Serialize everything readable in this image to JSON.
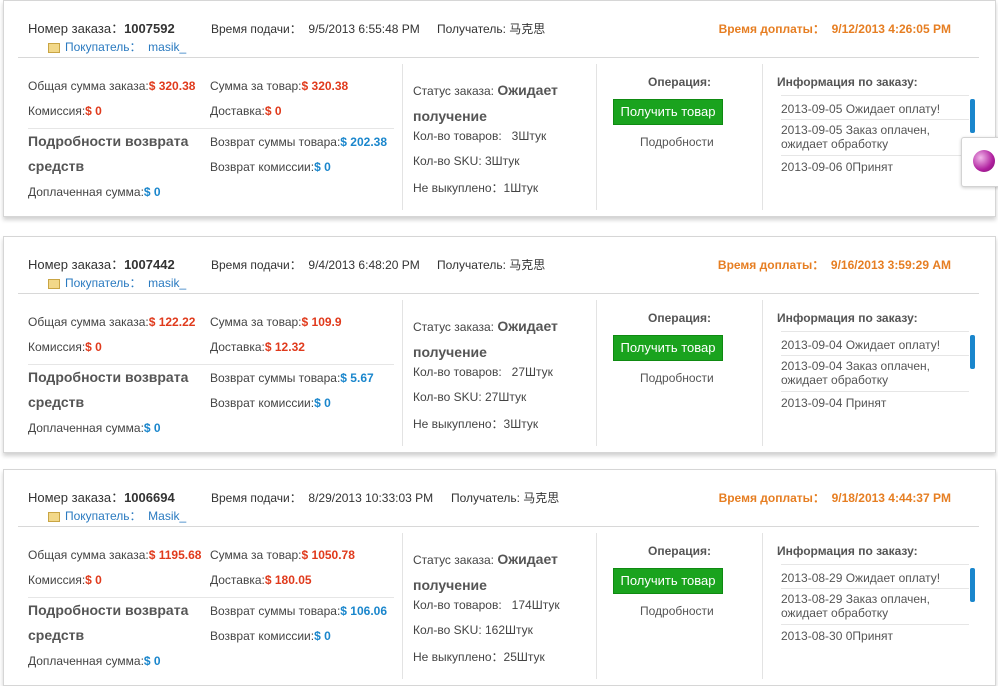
{
  "labels": {
    "order_number": "Номер заказа：",
    "submit_time": "Время подачи：",
    "recipient": "Получатель:",
    "pay_deadline": "Время доплаты：",
    "buyer": "Покупатель：",
    "total_order": "Общая сумма заказа:",
    "goods_sum": "Сумма за товар:",
    "commission": "Комиссия:",
    "delivery": "Доставка:",
    "refund_details": "Подробности возврата средств",
    "refund_goods": "Возврат суммы товара:",
    "refund_commission": "Возврат комиссии:",
    "paid_extra": "Доплаченная сумма:",
    "order_status": "Статус заказа:",
    "goods_count": "Кол-во товаров:",
    "sku_count": "Кол-во SKU:",
    "not_bought": "Не выкуплено：",
    "operation": "Операция:",
    "receive_btn": "Получить товар",
    "details_link": "Подробности",
    "order_info": "Информация по заказу:"
  },
  "orders": [
    {
      "number": "1007592",
      "submit_time": "9/5/2013 6:55:48 PM",
      "recipient": "马克思",
      "pay_deadline": "9/12/2013 4:26:05 PM",
      "buyer": "masik_",
      "total": "$ 320.38",
      "goods_sum": "$ 320.38",
      "commission": "$ 0",
      "delivery": "$ 0",
      "refund_goods": "$ 202.38",
      "refund_commission": "$ 0",
      "paid_extra": "$ 0",
      "status": "Ожидает получение",
      "goods_count": "3Штук",
      "sku_count": "3Штук",
      "not_bought": "1Штук",
      "info": [
        "2013-09-05 Ожидает оплату!",
        "2013-09-05 Заказ оплачен, ожидает обработку",
        "2013-09-06 0Принят"
      ]
    },
    {
      "number": "1007442",
      "submit_time": "9/4/2013 6:48:20 PM",
      "recipient": "马克思",
      "pay_deadline": "9/16/2013 3:59:29 AM",
      "buyer": "masik_",
      "total": "$ 122.22",
      "goods_sum": "$ 109.9",
      "commission": "$ 0",
      "delivery": "$ 12.32",
      "refund_goods": "$ 5.67",
      "refund_commission": "$ 0",
      "paid_extra": "$ 0",
      "status": "Ожидает получение",
      "goods_count": "27Штук",
      "sku_count": "27Штук",
      "not_bought": "3Штук",
      "info": [
        "2013-09-04 Ожидает оплату!",
        "2013-09-04 Заказ оплачен, ожидает обработку",
        "2013-09-04 Принят"
      ]
    },
    {
      "number": "1006694",
      "submit_time": "8/29/2013 10:33:03 PM",
      "recipient": "马克思",
      "pay_deadline": "9/18/2013 4:44:37 PM",
      "buyer": "Masik_",
      "total": "$ 1195.68",
      "goods_sum": "$ 1050.78",
      "commission": "$ 0",
      "delivery": "$ 180.05",
      "refund_goods": "$ 106.06",
      "refund_commission": "$ 0",
      "paid_extra": "$ 0",
      "status": "Ожидает получение",
      "goods_count": "174Штук",
      "sku_count": "162Штук",
      "not_bought": "25Штук",
      "info": [
        "2013-08-29 Ожидает оплату!",
        "2013-08-29 Заказ оплачен, ожидает обработку",
        "2013-08-30 0Принят"
      ]
    }
  ],
  "colors": {
    "accent_orange": "#e67e22",
    "money_red": "#e03a1c",
    "money_blue": "#1a86cc",
    "button_green": "#1aa31e"
  },
  "widget": {
    "icon": "globe-icon"
  }
}
